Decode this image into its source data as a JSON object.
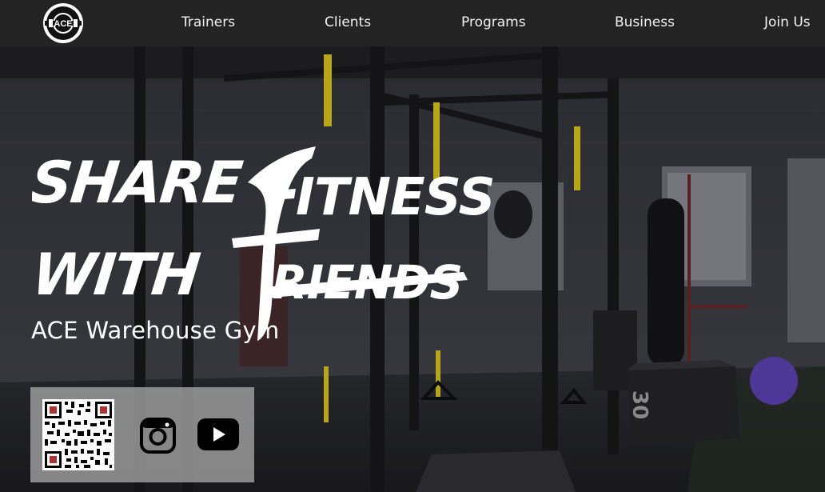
{
  "nav": {
    "logo_icon": "ace-warehouse-gym-logo",
    "items": [
      {
        "label": "Trainers"
      },
      {
        "label": "Clients"
      },
      {
        "label": "Programs"
      },
      {
        "label": "Business"
      },
      {
        "label": "Join Us"
      }
    ]
  },
  "hero": {
    "slogan_line1": "SHARE FITNESS",
    "slogan_line2": "WITH FRIENDS",
    "gym_name": "ACE Warehouse Gym",
    "box_number": "30"
  },
  "social": {
    "qr_icon": "qr-code",
    "instagram_icon": "instagram-icon",
    "youtube_icon": "youtube-icon"
  },
  "colors": {
    "nav_bg": "#232323",
    "panel_bg": "#a5a5a5",
    "strap_yellow": "#d6c21c",
    "ball_purple": "#5b3fb0"
  }
}
